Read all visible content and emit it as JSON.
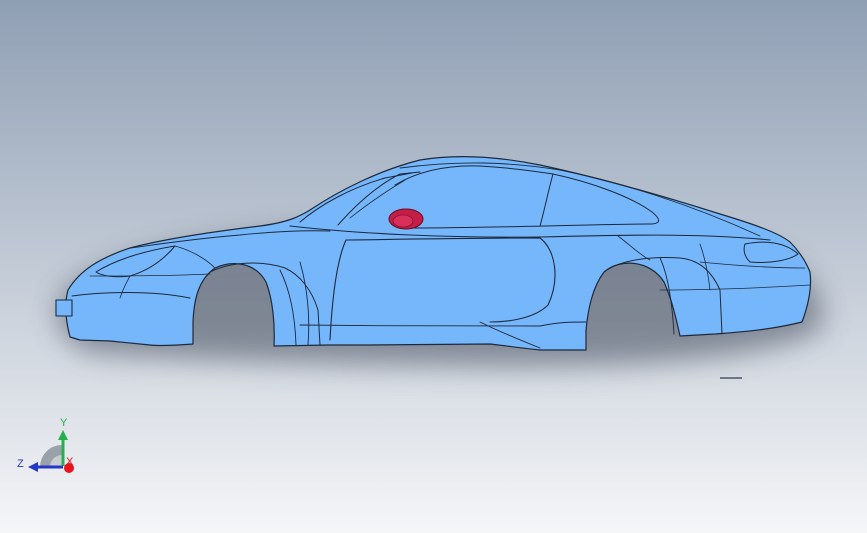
{
  "viewport": {
    "background_top": "#8f9fb4",
    "background_bottom": "#f5f6f8",
    "model_fill": "#76b6fb",
    "model_edge": "#1c2a3c",
    "highlight_part": "#c41e48"
  },
  "model": {
    "part_name": "",
    "highlighted_part_icon": "mirror-part"
  },
  "triad": {
    "y_label": "Y",
    "z_label": "Z",
    "x_label": "X",
    "y_color": "#22b24c",
    "z_color": "#2438c8",
    "x_color": "#e8141e"
  }
}
